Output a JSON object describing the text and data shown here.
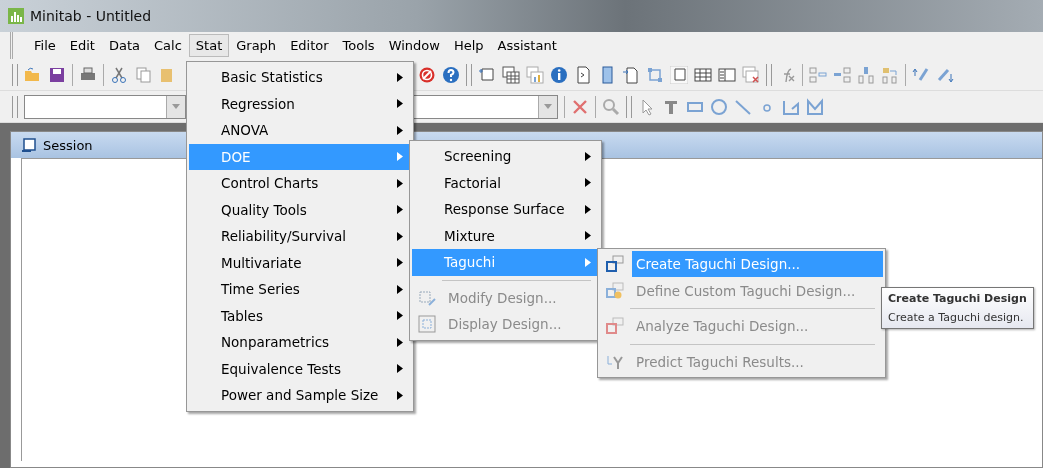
{
  "window": {
    "title": "Minitab - Untitled"
  },
  "menubar": [
    {
      "label": "File",
      "selected": false
    },
    {
      "label": "Edit",
      "selected": false
    },
    {
      "label": "Data",
      "selected": false
    },
    {
      "label": "Calc",
      "selected": false
    },
    {
      "label": "Stat",
      "selected": true
    },
    {
      "label": "Graph",
      "selected": false
    },
    {
      "label": "Editor",
      "selected": false
    },
    {
      "label": "Tools",
      "selected": false
    },
    {
      "label": "Window",
      "selected": false
    },
    {
      "label": "Help",
      "selected": false
    },
    {
      "label": "Assistant",
      "selected": false
    }
  ],
  "session": {
    "title": "Session"
  },
  "stat_menu": [
    {
      "label": "Basic Statistics",
      "selected": false
    },
    {
      "label": "Regression",
      "selected": false
    },
    {
      "label": "ANOVA",
      "selected": false
    },
    {
      "label": "DOE",
      "selected": true
    },
    {
      "label": "Control Charts",
      "selected": false
    },
    {
      "label": "Quality Tools",
      "selected": false
    },
    {
      "label": "Reliability/Survival",
      "selected": false
    },
    {
      "label": "Multivariate",
      "selected": false
    },
    {
      "label": "Time Series",
      "selected": false
    },
    {
      "label": "Tables",
      "selected": false
    },
    {
      "label": "Nonparametrics",
      "selected": false
    },
    {
      "label": "Equivalence Tests",
      "selected": false
    },
    {
      "label": "Power and Sample Size",
      "selected": false
    }
  ],
  "doe_menu": [
    {
      "kind": "submenu",
      "label": "Screening",
      "selected": false,
      "disabled": false
    },
    {
      "kind": "submenu",
      "label": "Factorial",
      "selected": false,
      "disabled": false
    },
    {
      "kind": "submenu",
      "label": "Response Surface",
      "selected": false,
      "disabled": false
    },
    {
      "kind": "submenu",
      "label": "Mixture",
      "selected": false,
      "disabled": false
    },
    {
      "kind": "submenu",
      "label": "Taguchi",
      "selected": true,
      "disabled": false
    },
    {
      "kind": "separator"
    },
    {
      "kind": "command",
      "label": "Modify Design...",
      "selected": false,
      "disabled": true
    },
    {
      "kind": "command",
      "label": "Display Design...",
      "selected": false,
      "disabled": true
    }
  ],
  "taguchi_menu": [
    {
      "kind": "command",
      "label": "Create Taguchi Design...",
      "selected": true,
      "disabled": false
    },
    {
      "kind": "command",
      "label": "Define Custom Taguchi Design...",
      "selected": false,
      "disabled": true
    },
    {
      "kind": "separator"
    },
    {
      "kind": "command",
      "label": "Analyze Taguchi Design...",
      "selected": false,
      "disabled": true
    },
    {
      "kind": "separator"
    },
    {
      "kind": "command",
      "label": "Predict Taguchi Results...",
      "selected": false,
      "disabled": true
    }
  ],
  "tooltip": {
    "title": "Create Taguchi Design",
    "text": "Create a Taguchi design."
  }
}
